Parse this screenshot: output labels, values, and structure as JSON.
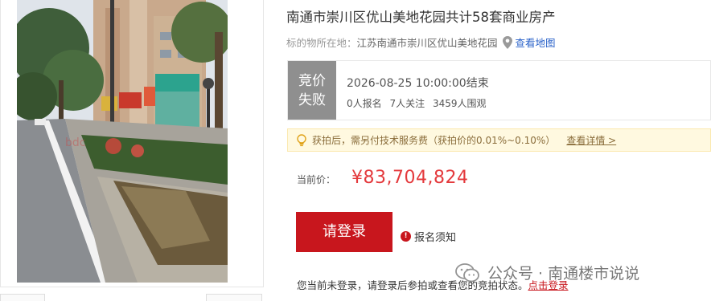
{
  "listing": {
    "title": "南通市崇川区优山美地花园共计58套商业房产",
    "location_label": "标的物所在地：",
    "location_value": "江苏南通市崇川区优山美地花园",
    "map_link": "查看地图"
  },
  "status": {
    "tag_line1": "竞价",
    "tag_line2": "失败",
    "end_time": "2026-08-25 10:00:00结束",
    "signups": "0人报名",
    "followers": "7人关注",
    "viewers": "3459人围观"
  },
  "notice": {
    "text": "获拍后，需另付技术服务费（获拍价的0.01%~0.10%）",
    "link": "查看详情 >"
  },
  "price": {
    "label": "当前价：",
    "value": "¥83,704,824"
  },
  "actions": {
    "login_button": "请登录",
    "signup_notes": "报名须知",
    "login_hint": "您当前未登录，请登录后参拍或查看您的竞拍状态。",
    "login_hint_link": "点击登录"
  },
  "watermark": {
    "text": "公众号 · 南通楼市说说"
  },
  "colors": {
    "accent": "#c8161d",
    "price": "#e4393c",
    "status_tag": "#8f8f8f",
    "link": "#2a62c9",
    "notice_bg": "#fff9e0"
  }
}
